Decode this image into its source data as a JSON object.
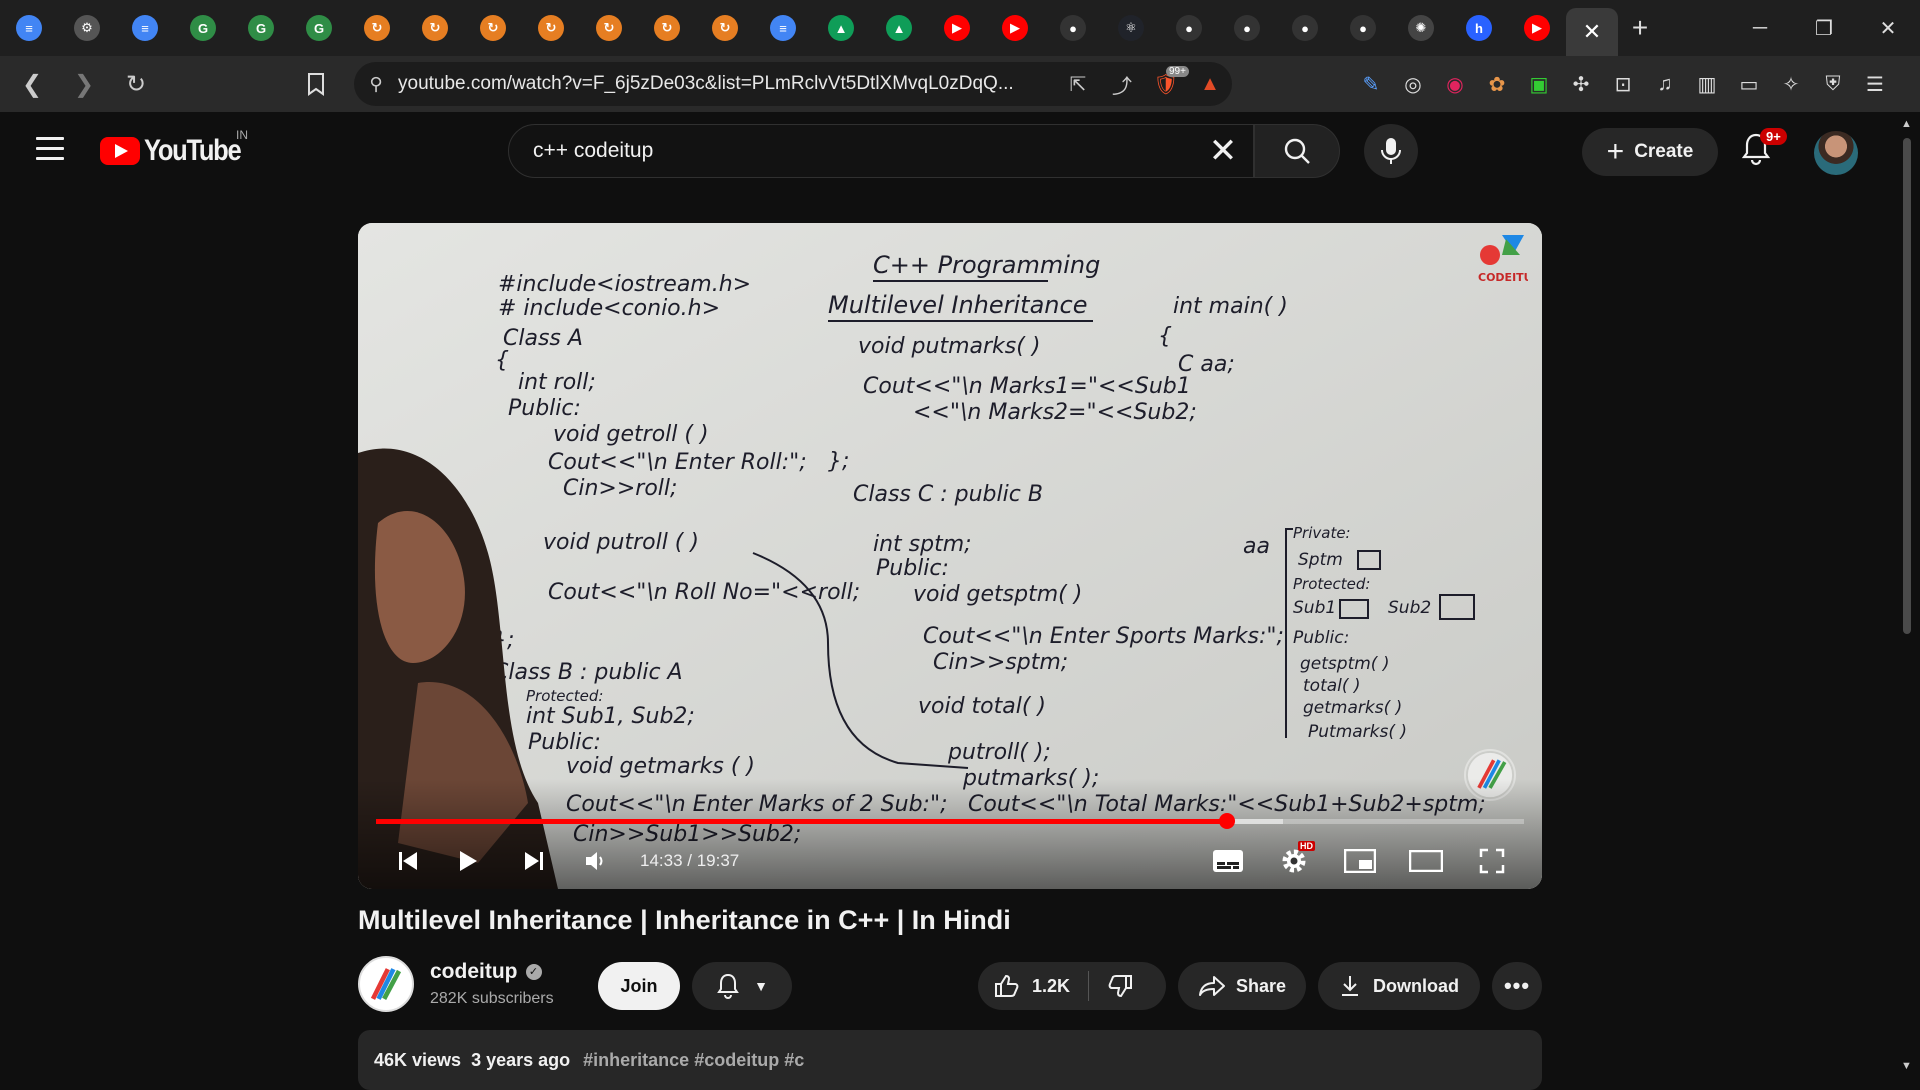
{
  "browser": {
    "tabs": [
      {
        "icon": "docs-icon",
        "color": "#4285f4",
        "glyph": "≡"
      },
      {
        "icon": "ide-icon",
        "color": "#555",
        "glyph": "⚙"
      },
      {
        "icon": "docs-icon",
        "color": "#4285f4",
        "glyph": "≡"
      },
      {
        "icon": "gfg-icon",
        "color": "#2f8d46",
        "glyph": "G"
      },
      {
        "icon": "gfg-icon",
        "color": "#2f8d46",
        "glyph": "G"
      },
      {
        "icon": "gfg-icon",
        "color": "#2f8d46",
        "glyph": "G"
      },
      {
        "icon": "loader-icon",
        "color": "#e67e22",
        "glyph": "↻"
      },
      {
        "icon": "loader-icon",
        "color": "#e67e22",
        "glyph": "↻"
      },
      {
        "icon": "loader-icon",
        "color": "#e67e22",
        "glyph": "↻"
      },
      {
        "icon": "loader-icon",
        "color": "#e67e22",
        "glyph": "↻"
      },
      {
        "icon": "loader-icon",
        "color": "#e67e22",
        "glyph": "↻"
      },
      {
        "icon": "loader-icon",
        "color": "#e67e22",
        "glyph": "↻"
      },
      {
        "icon": "loader-icon",
        "color": "#e67e22",
        "glyph": "↻"
      },
      {
        "icon": "docs-icon",
        "color": "#4285f4",
        "glyph": "≡"
      },
      {
        "icon": "drive-icon",
        "color": "#0f9d58",
        "glyph": "▲"
      },
      {
        "icon": "drive-icon",
        "color": "#0f9d58",
        "glyph": "▲"
      },
      {
        "icon": "youtube-icon",
        "color": "#ff0000",
        "glyph": "▶"
      },
      {
        "icon": "youtube-icon",
        "color": "#ff0000",
        "glyph": "▶"
      },
      {
        "icon": "github-icon",
        "color": "#333",
        "glyph": "●"
      },
      {
        "icon": "react-icon",
        "color": "#20232a",
        "glyph": "⚛"
      },
      {
        "icon": "github-icon",
        "color": "#333",
        "glyph": "●"
      },
      {
        "icon": "github-icon",
        "color": "#333",
        "glyph": "●"
      },
      {
        "icon": "github-icon",
        "color": "#333",
        "glyph": "●"
      },
      {
        "icon": "github-icon",
        "color": "#333",
        "glyph": "●"
      },
      {
        "icon": "chatgpt-icon",
        "color": "#444",
        "glyph": "✺"
      },
      {
        "icon": "hashnode-icon",
        "color": "#2962ff",
        "glyph": "h"
      },
      {
        "icon": "youtube-icon",
        "color": "#ff0000",
        "glyph": "▶"
      }
    ],
    "active_tab_close": "✕",
    "new_tab": "+",
    "window": {
      "minimize": "─",
      "restore": "❐",
      "close": "✕"
    },
    "url": "youtube.com/watch?v=F_6j5zDe03c&list=PLmRclvVt5DtlXMvqL0zDqQ...",
    "brave_badge": "99+"
  },
  "youtube": {
    "country": "IN",
    "logo_text": "YouTube",
    "search_query": "c++ codeitup",
    "create_label": "Create",
    "notif_badge": "9+"
  },
  "video": {
    "elapsed": "14:33",
    "duration": "19:37",
    "played_fraction": 0.7417,
    "quality_badge": "HD",
    "board": {
      "header1": "C++ Programming",
      "header2": "Multilevel Inheritance"
    }
  },
  "meta": {
    "title": "Multilevel Inheritance | Inheritance in C++ | In Hindi",
    "channel": "codeitup",
    "subscribers": "282K subscribers",
    "join": "Join",
    "likes": "1.2K",
    "share": "Share",
    "download": "Download",
    "views": "46K views",
    "age": "3 years ago",
    "tags": "#inheritance #codeitup #c"
  }
}
